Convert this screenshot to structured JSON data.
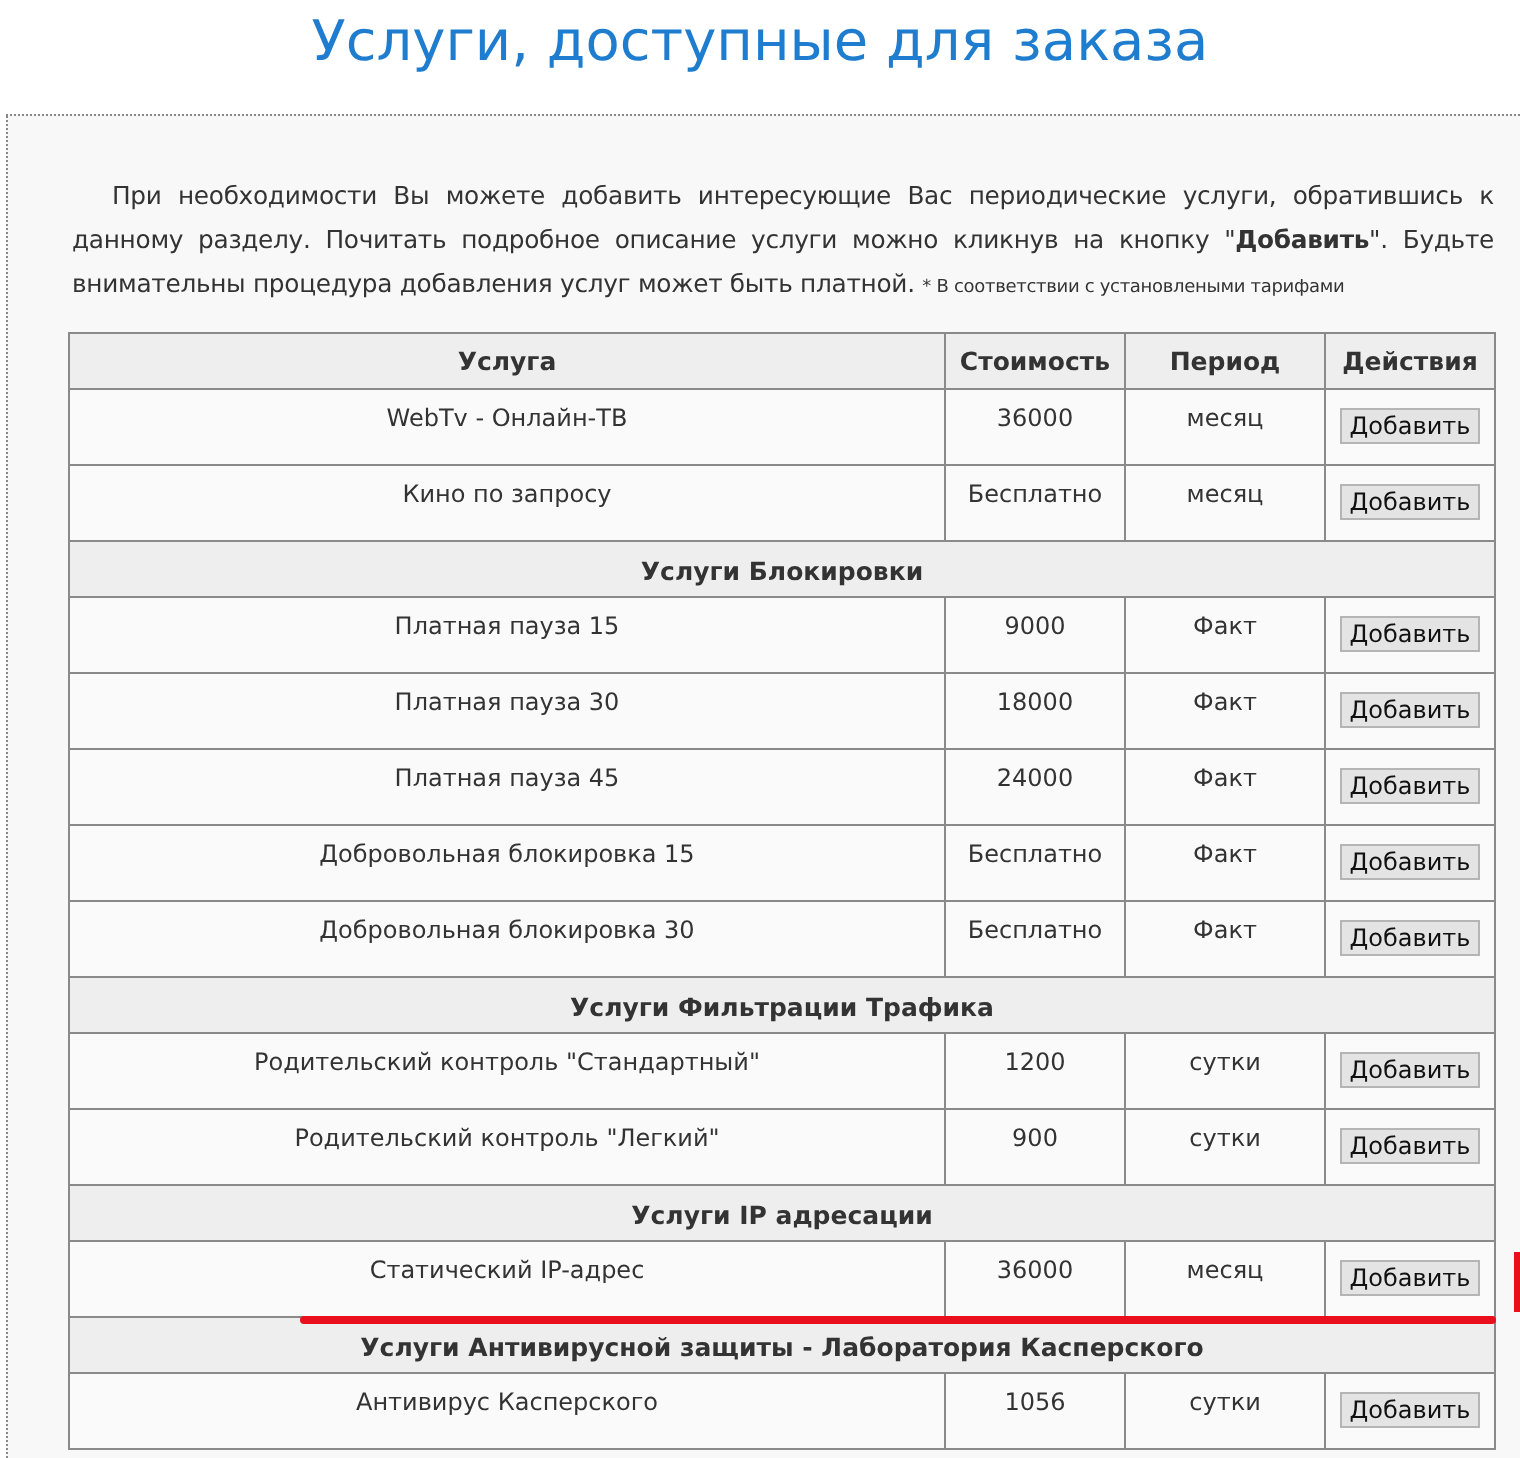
{
  "title": "Услуги, доступные для заказа",
  "intro": "При необходимости Вы можете добавить интересующие Вас периодические услуги, обратившись к данному разделу. Почитать подробное описание услуги можно кликнув на кнопку \"**Добавить**\". Будьте внимательны процедура добавления услуг может быть платной.",
  "footnote": "* В соответствии с установлеными тарифами",
  "table": {
    "columns": [
      "Услуга",
      "Стоимость",
      "Период",
      "Действия"
    ],
    "rows": [
      {
        "kind": "service",
        "name": "WebTv - Онлайн-ТВ",
        "price": "36000",
        "period": "месяц",
        "action": "Добавить",
        "highlighted": false
      },
      {
        "kind": "service",
        "name": "Кино по запросу",
        "price": "Бесплатно",
        "period": "месяц",
        "action": "Добавить",
        "highlighted": false
      },
      {
        "kind": "section",
        "title": "Услуги Блокировки"
      },
      {
        "kind": "service",
        "name": "Платная пауза 15",
        "price": "9000",
        "period": "Факт",
        "action": "Добавить",
        "highlighted": false
      },
      {
        "kind": "service",
        "name": "Платная пауза 30",
        "price": "18000",
        "period": "Факт",
        "action": "Добавить",
        "highlighted": false
      },
      {
        "kind": "service",
        "name": "Платная пауза 45",
        "price": "24000",
        "period": "Факт",
        "action": "Добавить",
        "highlighted": false
      },
      {
        "kind": "service",
        "name": "Добровольная блокировка 15",
        "price": "Бесплатно",
        "period": "Факт",
        "action": "Добавить",
        "highlighted": false
      },
      {
        "kind": "service",
        "name": "Добровольная блокировка 30",
        "price": "Бесплатно",
        "period": "Факт",
        "action": "Добавить",
        "highlighted": false
      },
      {
        "kind": "section",
        "title": "Услуги Фильтрации Трафика"
      },
      {
        "kind": "service",
        "name": "Родительский контроль \"Стандартный\"",
        "price": "1200",
        "period": "сутки",
        "action": "Добавить",
        "highlighted": false
      },
      {
        "kind": "service",
        "name": "Родительский контроль \"Легкий\"",
        "price": "900",
        "period": "сутки",
        "action": "Добавить",
        "highlighted": false
      },
      {
        "kind": "section",
        "title": "Услуги IP адресации"
      },
      {
        "kind": "service",
        "name": "Статический IP-адрес",
        "price": "36000",
        "period": "месяц",
        "action": "Добавить",
        "highlighted": true
      },
      {
        "kind": "section",
        "title": "Услуги Антивирусной защиты - Лаборатория Касперского"
      },
      {
        "kind": "service",
        "name": "Антивирус Касперского",
        "price": "1056",
        "period": "сутки",
        "action": "Добавить",
        "highlighted": false
      }
    ]
  }
}
